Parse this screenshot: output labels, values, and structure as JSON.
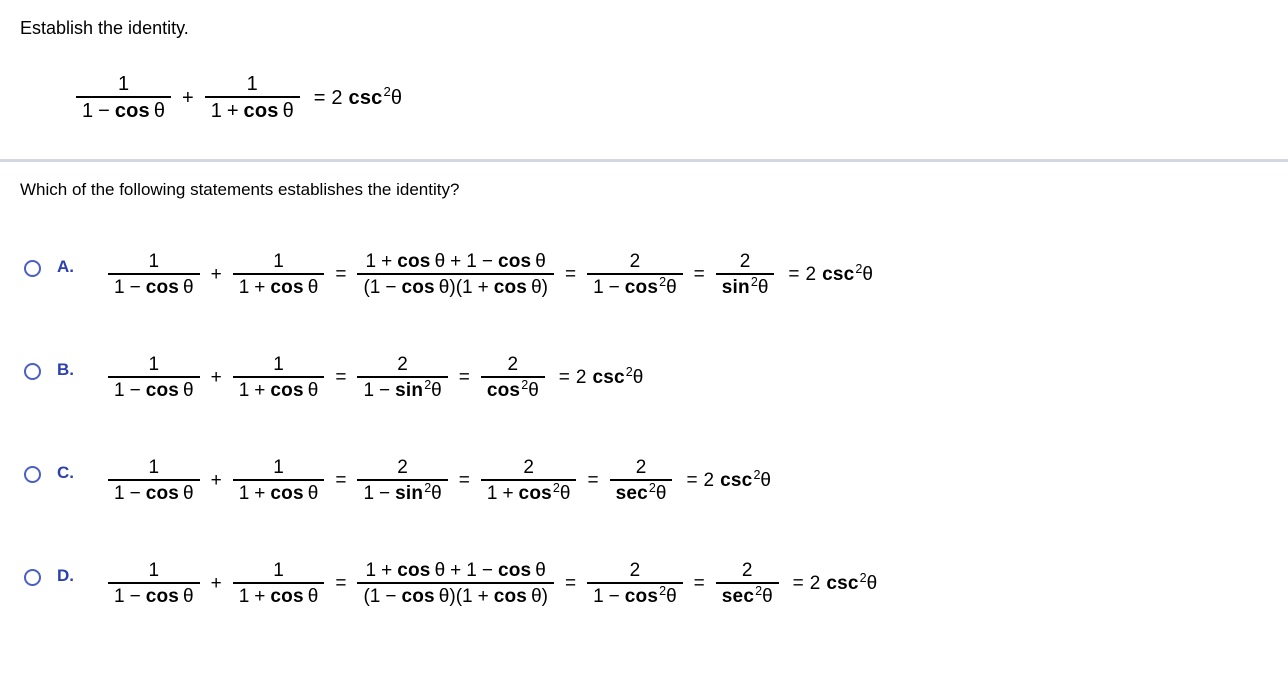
{
  "heading": "Establish the identity.",
  "question": "Which of the following statements establishes the identity?",
  "colors": {
    "radio_ring": "#4b5fc4",
    "option_letter": "#2c40b0",
    "divider": "#d4d7e1",
    "text": "#000000",
    "background": "#ffffff"
  },
  "main_equation": {
    "left_term_1": {
      "numerator": "1",
      "denominator": "1 − cos θ"
    },
    "operator": "+",
    "left_term_2": {
      "numerator": "1",
      "denominator": "1 + cos θ"
    },
    "equals": "=",
    "right_side": "2 csc 2θ",
    "right_side_coefficient": "2",
    "right_side_function": "csc",
    "right_side_exponent": "2",
    "right_side_variable": "θ"
  },
  "options": [
    {
      "letter": "A.",
      "selected": false,
      "steps": [
        {
          "type": "fraction",
          "num": "1",
          "den": "1 − cos θ"
        },
        {
          "type": "operator",
          "text": "+"
        },
        {
          "type": "fraction",
          "num": "1",
          "den": "1 + cos θ"
        },
        {
          "type": "operator",
          "text": "="
        },
        {
          "type": "fraction",
          "num": "1 + cos θ + 1 − cos θ",
          "den": "(1 − cos θ)(1 + cos θ)"
        },
        {
          "type": "operator",
          "text": "="
        },
        {
          "type": "fraction",
          "num": "2",
          "den": "1 − cos ²θ"
        },
        {
          "type": "operator",
          "text": "="
        },
        {
          "type": "fraction",
          "num": "2",
          "den": "sin ²θ"
        },
        {
          "type": "operator",
          "text": "="
        },
        {
          "type": "result",
          "text": "2 csc ²θ"
        }
      ]
    },
    {
      "letter": "B.",
      "selected": false,
      "steps": [
        {
          "type": "fraction",
          "num": "1",
          "den": "1 − cos θ"
        },
        {
          "type": "operator",
          "text": "+"
        },
        {
          "type": "fraction",
          "num": "1",
          "den": "1 + cos θ"
        },
        {
          "type": "operator",
          "text": "="
        },
        {
          "type": "fraction",
          "num": "2",
          "den": "1 − sin ²θ"
        },
        {
          "type": "operator",
          "text": "="
        },
        {
          "type": "fraction",
          "num": "2",
          "den": "cos ²θ"
        },
        {
          "type": "operator",
          "text": "="
        },
        {
          "type": "result",
          "text": "2 csc ²θ"
        }
      ]
    },
    {
      "letter": "C.",
      "selected": false,
      "steps": [
        {
          "type": "fraction",
          "num": "1",
          "den": "1 − cos θ"
        },
        {
          "type": "operator",
          "text": "+"
        },
        {
          "type": "fraction",
          "num": "1",
          "den": "1 + cos θ"
        },
        {
          "type": "operator",
          "text": "="
        },
        {
          "type": "fraction",
          "num": "2",
          "den": "1 − sin ²θ"
        },
        {
          "type": "operator",
          "text": "="
        },
        {
          "type": "fraction",
          "num": "2",
          "den": "1 + cos ²θ"
        },
        {
          "type": "operator",
          "text": "="
        },
        {
          "type": "fraction",
          "num": "2",
          "den": "sec ²θ"
        },
        {
          "type": "operator",
          "text": "="
        },
        {
          "type": "result",
          "text": "2 csc ²θ"
        }
      ]
    },
    {
      "letter": "D.",
      "selected": false,
      "steps": [
        {
          "type": "fraction",
          "num": "1",
          "den": "1 − cos θ"
        },
        {
          "type": "operator",
          "text": "+"
        },
        {
          "type": "fraction",
          "num": "1",
          "den": "1 + cos θ"
        },
        {
          "type": "operator",
          "text": "="
        },
        {
          "type": "fraction",
          "num": "1 + cos θ + 1 − cos θ",
          "den": "(1 − cos θ)(1 + cos θ)"
        },
        {
          "type": "operator",
          "text": "="
        },
        {
          "type": "fraction",
          "num": "2",
          "den": "1 − cos ²θ"
        },
        {
          "type": "operator",
          "text": "="
        },
        {
          "type": "fraction",
          "num": "2",
          "den": "sec ²θ"
        },
        {
          "type": "operator",
          "text": "="
        },
        {
          "type": "result",
          "text": "2 csc ²θ"
        }
      ]
    }
  ],
  "tokens": {
    "one": "1",
    "two": "2",
    "plus": "+",
    "minus": "−",
    "equals": "=",
    "cos": "cos",
    "sin": "sin",
    "sec": "sec",
    "csc": "csc",
    "theta": "θ",
    "exp_two": "2",
    "lparen": "(",
    "rparen": ")"
  }
}
